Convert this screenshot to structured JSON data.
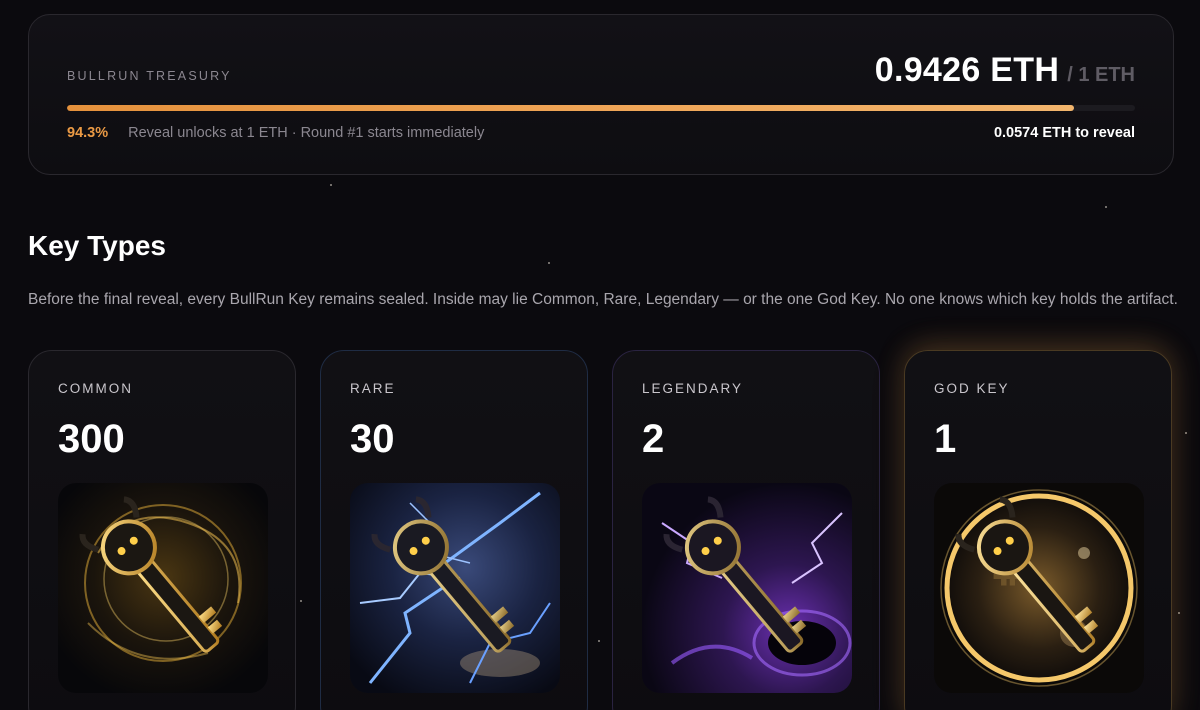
{
  "treasury": {
    "label": "BULLRUN TREASURY",
    "amount": "0.9426 ETH",
    "cap": "/ 1 ETH",
    "progress_fraction": 0.943,
    "percent": "94.3%",
    "info": "Reveal unlocks at 1 ETH · Round #1 starts immediately",
    "remaining": "0.0574 ETH to reveal"
  },
  "key_types": {
    "title": "Key Types",
    "description": "Before the final reveal, every BullRun Key remains sealed. Inside may lie Common, Rare, Legendary — or the one God Key. No one knows which key holds the artifact.",
    "cards": [
      {
        "label": "COMMON",
        "count": "300",
        "art": "common-key-art",
        "accent": "#f4c04a"
      },
      {
        "label": "RARE",
        "count": "30",
        "art": "rare-key-art",
        "accent": "#4f8cff"
      },
      {
        "label": "LEGENDARY",
        "count": "2",
        "art": "legendary-key-art",
        "accent": "#9b5cff"
      },
      {
        "label": "GOD KEY",
        "count": "1",
        "art": "god-key-art",
        "accent": "#f2b04a"
      }
    ]
  },
  "colors": {
    "background": "#0b0a0e",
    "progress": "#eb9a45",
    "muted_text": "#8b8790"
  }
}
